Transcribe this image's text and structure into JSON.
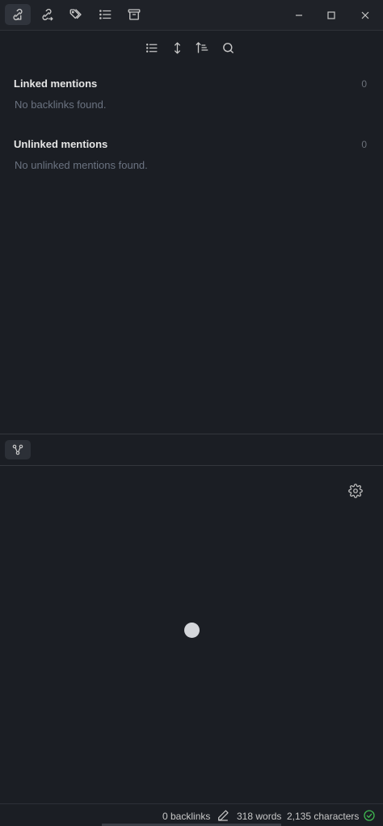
{
  "tabs": [
    {
      "icon": "backlinks-icon",
      "active": true
    },
    {
      "icon": "outgoing-links-icon",
      "active": false
    },
    {
      "icon": "tags-icon",
      "active": false
    },
    {
      "icon": "outline-icon",
      "active": false
    },
    {
      "icon": "archive-icon",
      "active": false
    }
  ],
  "window_controls": [
    "minimize-icon",
    "maximize-icon",
    "close-icon"
  ],
  "backlinks": {
    "toolbar_icons": [
      "list-icon",
      "expand-collapse-icon",
      "sort-icon",
      "search-icon"
    ],
    "linked": {
      "title": "Linked mentions",
      "count": "0",
      "empty": "No backlinks found."
    },
    "unlinked": {
      "title": "Unlinked mentions",
      "count": "0",
      "empty": "No unlinked mentions found."
    }
  },
  "graph": {
    "tab_icon": "graph-icon",
    "settings_icon": "gear-icon"
  },
  "status": {
    "backlinks": "0 backlinks",
    "words": "318 words",
    "characters": "2,135 characters"
  },
  "colors": {
    "background": "#1b1e24",
    "text_muted": "#6b7381",
    "sync_ok": "#3fb950"
  }
}
